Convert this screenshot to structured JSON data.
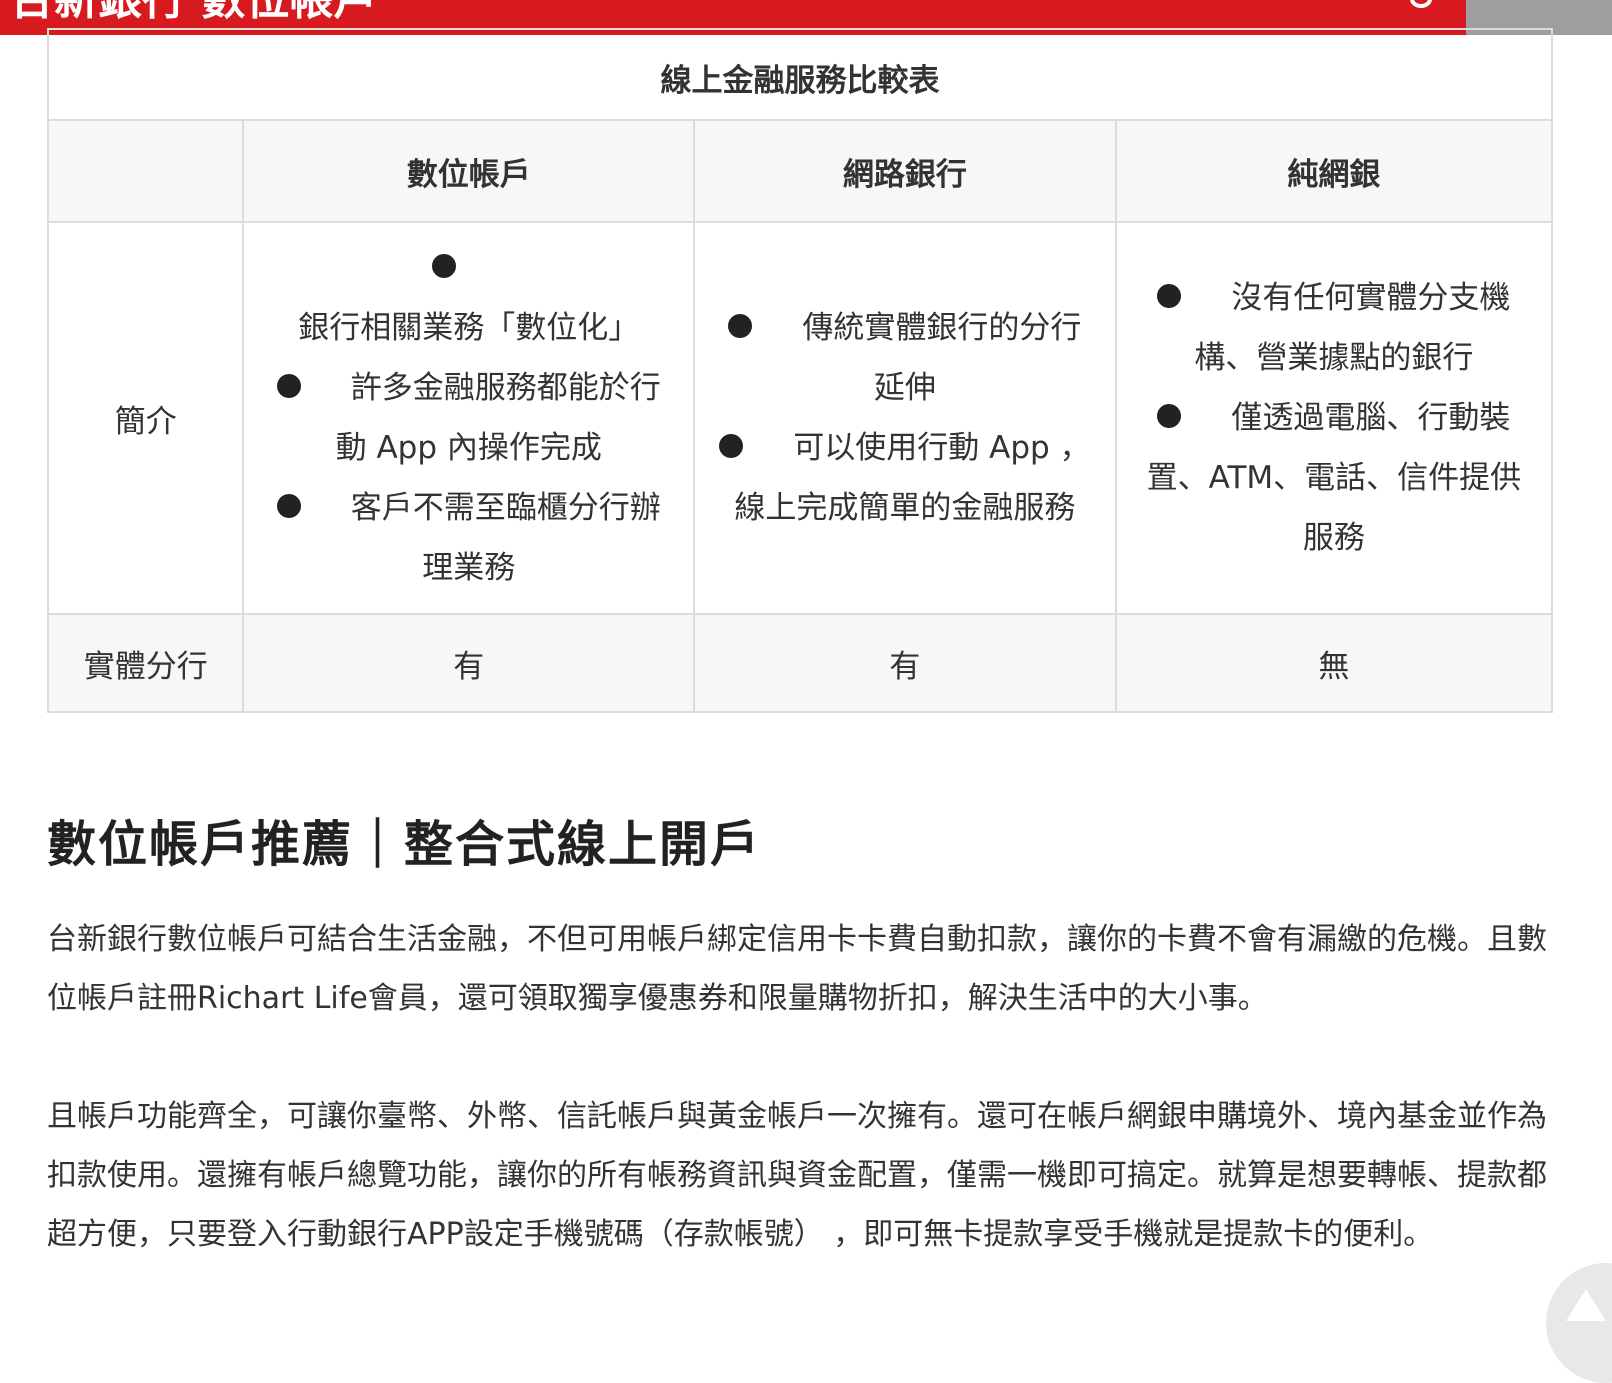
{
  "header": {
    "brand": "台新銀行 數位帳戶"
  },
  "table": {
    "caption": "線上金融服務比較表",
    "columns": [
      "",
      "數位帳戶",
      "網路銀行",
      "純網銀"
    ],
    "intro": {
      "label": "簡介",
      "digital_account": [
        "銀行相關業務「數位化」",
        "許多金融服務都能於行動 App 內操作完成",
        "客戶不需至臨櫃分行辦理業務"
      ],
      "online_banking": [
        "傳統實體銀行的分行延伸",
        "可以使用行動 App ，線上完成簡單的金融服務"
      ],
      "pure_online_bank": [
        "沒有任何實體分支機構、營業據點的銀行",
        "僅透過電腦、行動裝置、ATM、電話、信件提供服務"
      ]
    },
    "branch": {
      "label": "實體分行",
      "values": [
        "有",
        "有",
        "無"
      ]
    }
  },
  "section": {
    "title": "數位帳戶推薦｜整合式線上開戶",
    "paragraphs": [
      "台新銀行數位帳戶可結合生活金融，不但可用帳戶綁定信用卡卡費自動扣款，讓你的卡費不會有漏繳的危機。且數位帳戶註冊Richart Life會員，還可領取獨享優惠券和限量購物折扣，解決生活中的大小事。",
      "且帳戶功能齊全，可讓你臺幣、外幣、信託帳戶與黃金帳戶一次擁有。還可在帳戶網銀申購境外、境內基金並作為扣款使用。還擁有帳戶總覽功能，讓你的所有帳務資訊與資金配置，僅需一機即可搞定。就算是想要轉帳、提款都超方便，只要登入行動銀行APP設定手機號碼（存款帳號） ，即可無卡提款享受手機就是提款卡的便利。"
    ]
  },
  "colors": {
    "brand_red": "#d71920",
    "table_border": "#dcdcdc",
    "table_head_bg": "#f7f7f7"
  },
  "icons": {
    "scroll_top": "triangle-up-icon"
  }
}
